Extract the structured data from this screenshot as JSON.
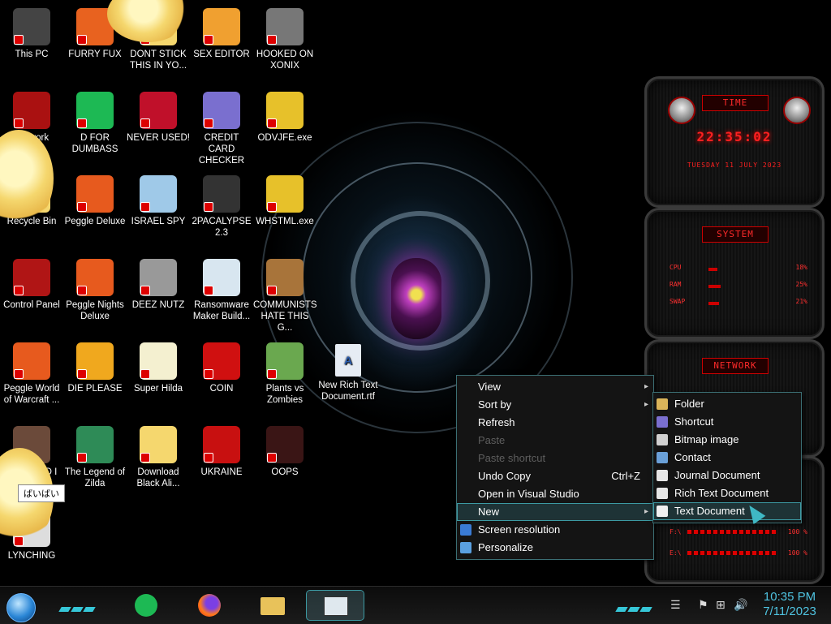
{
  "desktop": {
    "file_on_wallpaper": "New Rich Text Document.rtf",
    "tooltip": "ばいばい",
    "icons": [
      {
        "label": "This PC",
        "color": "#444"
      },
      {
        "label": "FURRY FUX",
        "color": "#e8621f"
      },
      {
        "label": "DONT STICK THIS IN YO...",
        "color": "#f5d76e"
      },
      {
        "label": "SEX EDITOR",
        "color": "#f0a030"
      },
      {
        "label": "HOOKED ON XONIX",
        "color": "#777"
      },
      {
        "label": "Network",
        "color": "#a11"
      },
      {
        "label": "D FOR DUMBASS",
        "color": "#1db954"
      },
      {
        "label": "NEVER USED!",
        "color": "#c0102a"
      },
      {
        "label": "CREDIT CARD CHECKER",
        "color": "#7a6fcf"
      },
      {
        "label": "ODVJFE.exe",
        "color": "#e7c12a"
      },
      {
        "label": "Recycle Bin",
        "color": "#f5d76e"
      },
      {
        "label": "Peggle Deluxe",
        "color": "#e75a1e"
      },
      {
        "label": "ISRAEL SPY",
        "color": "#9fc9e8"
      },
      {
        "label": "2PACALYPSE 2.3",
        "color": "#333"
      },
      {
        "label": "WHSTML.exe",
        "color": "#e7c12a"
      },
      {
        "label": "Control Panel",
        "color": "#b01515"
      },
      {
        "label": "Peggle Nights Deluxe",
        "color": "#e75a1e"
      },
      {
        "label": "DEEZ NUTZ",
        "color": "#999"
      },
      {
        "label": "Ransomware Maker Build...",
        "color": "#d8e6f0"
      },
      {
        "label": "COMMUNISTS HATE THIS G...",
        "color": "#a8743a"
      },
      {
        "label": "Peggle World of Warcraft ...",
        "color": "#e75a1e"
      },
      {
        "label": "DIE PLEASE",
        "color": "#f0a81e"
      },
      {
        "label": "Super Hilda",
        "color": "#f4f0d0"
      },
      {
        "label": "COIN",
        "color": "#d01010"
      },
      {
        "label": "Plants vs Zombies",
        "color": "#6aa84f"
      },
      {
        "label": "OOPS DID I DO THAT",
        "color": "#6b4a3a"
      },
      {
        "label": "The Legend of Zilda",
        "color": "#2e8b57"
      },
      {
        "label": "Download Black Ali...",
        "color": "#f5d76e"
      },
      {
        "label": "UKRAINE",
        "color": "#c81010"
      },
      {
        "label": "OOPS",
        "color": "#3a1515"
      },
      {
        "label": "LYNCHING",
        "color": "#ddd"
      }
    ]
  },
  "widgets": {
    "time_title": "TIME",
    "clock": "22:35:02",
    "date": "TUESDAY 11 JULY 2023",
    "system_title": "SYSTEM",
    "stats": [
      {
        "name": "CPU",
        "value": "18%",
        "level": 18
      },
      {
        "name": "RAM",
        "value": "25%",
        "level": 25
      },
      {
        "name": "SWAP",
        "value": "21%",
        "level": 21
      }
    ],
    "network_title": "NETWORK",
    "drives": [
      {
        "name": "F:\\",
        "value": "100 %"
      },
      {
        "name": "E:\\",
        "value": "100 %"
      }
    ]
  },
  "context_menu": {
    "items": [
      {
        "label": "View",
        "arrow": "▸",
        "disabled": false
      },
      {
        "label": "Sort by",
        "arrow": "▸",
        "disabled": false
      },
      {
        "label": "Refresh",
        "disabled": false
      },
      {
        "label": "Paste",
        "disabled": true
      },
      {
        "label": "Paste shortcut",
        "disabled": true
      },
      {
        "label": "Undo Copy",
        "shortcut": "Ctrl+Z",
        "disabled": false
      },
      {
        "label": "Open in Visual Studio",
        "disabled": false
      },
      {
        "label": "New",
        "arrow": "▸",
        "disabled": false,
        "highlighted": true
      },
      {
        "label": "Screen resolution",
        "disabled": false,
        "icon_color": "#3a7bd5"
      },
      {
        "label": "Personalize",
        "disabled": false,
        "icon_color": "#5aa0e0"
      }
    ]
  },
  "submenu": {
    "items": [
      {
        "label": "Folder",
        "icon_color": "#d9b45a"
      },
      {
        "label": "Shortcut",
        "icon_color": "#7a6fcf"
      },
      {
        "label": "Bitmap image",
        "icon_color": "#d0d0d0"
      },
      {
        "label": "Contact",
        "icon_color": "#6aa0d8"
      },
      {
        "label": "Journal Document",
        "icon_color": "#e6e6e6"
      },
      {
        "label": "Rich Text Document",
        "icon_color": "#e6e6e6"
      },
      {
        "label": "Text Document",
        "icon_color": "#f0f0f0",
        "highlighted": true
      }
    ]
  },
  "taskbar": {
    "time": "10:35 PM",
    "date": "7/11/2023",
    "accent": "#36c7d8"
  }
}
